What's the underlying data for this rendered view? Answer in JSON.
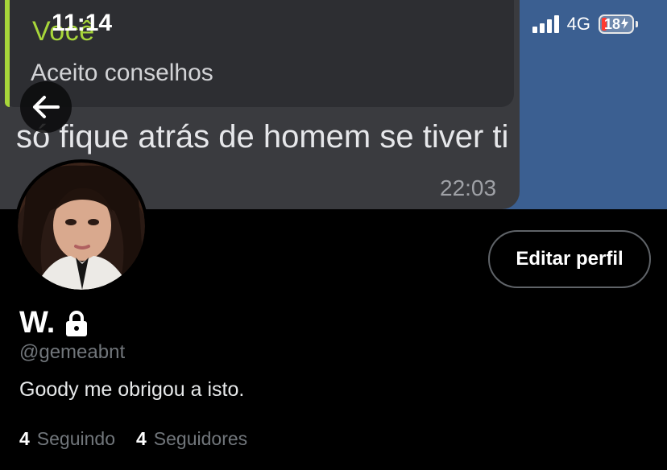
{
  "status_bar": {
    "time": "11:14",
    "network": "4G",
    "battery": "18",
    "battery_color": "#ff3b30"
  },
  "banner": {
    "reply_author": "Você",
    "reply_text": "Aceito conselhos",
    "message_text": "só fique atrás de homem se tiver ti",
    "message_time": "22:03",
    "accent_color": "#a7d63a",
    "background_color": "#3b5f91"
  },
  "header": {
    "back_icon": "arrow-left-icon"
  },
  "profile": {
    "display_name": "W.",
    "lock_icon": "lock-icon",
    "handle": "@gemeabnt",
    "bio": "Goody me obrigou a isto.",
    "edit_button_label": "Editar perfil",
    "following_count": "4",
    "following_label": "Seguindo",
    "followers_count": "4",
    "followers_label": "Seguidores"
  }
}
